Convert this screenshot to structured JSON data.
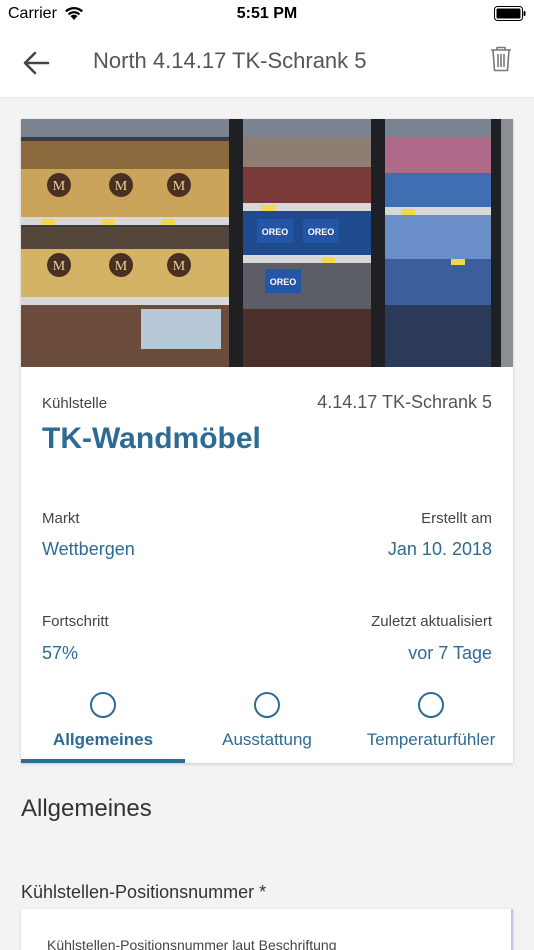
{
  "status_bar": {
    "carrier": "Carrier",
    "time": "5:51 PM"
  },
  "nav": {
    "title": "North 4.14.17 TK-Schrank 5"
  },
  "detail": {
    "kuehlstelle_label": "Kühlstelle",
    "kuehlstelle_code": "4.14.17 TK-Schrank 5",
    "name": "TK-Wandmöbel",
    "markt_label": "Markt",
    "markt_value": "Wettbergen",
    "erstellt_label": "Erstellt am",
    "erstellt_value": "Jan 10. 2018",
    "fortschritt_label": "Fortschritt",
    "fortschritt_value": "57%",
    "aktualisiert_label": "Zuletzt aktualisiert",
    "aktualisiert_value": "vor 7 Tage"
  },
  "tabs": [
    {
      "label": "Allgemeines",
      "active": true
    },
    {
      "label": "Ausstattung",
      "active": false
    },
    {
      "label": "Temperaturfühler",
      "active": false
    }
  ],
  "section": {
    "title": "Allgemeines",
    "field_label": "Kühlstellen-Positionsnummer *",
    "field_placeholder": "Kühlstellen-Positionsnummer laut Beschriftung"
  },
  "colors": {
    "accent": "#2d6b95",
    "background": "#f3f3f3"
  },
  "hero_image": {
    "product_labels": [
      "M",
      "M",
      "M",
      "M",
      "M",
      "M",
      "OREO",
      "OREO",
      "OREO"
    ]
  }
}
